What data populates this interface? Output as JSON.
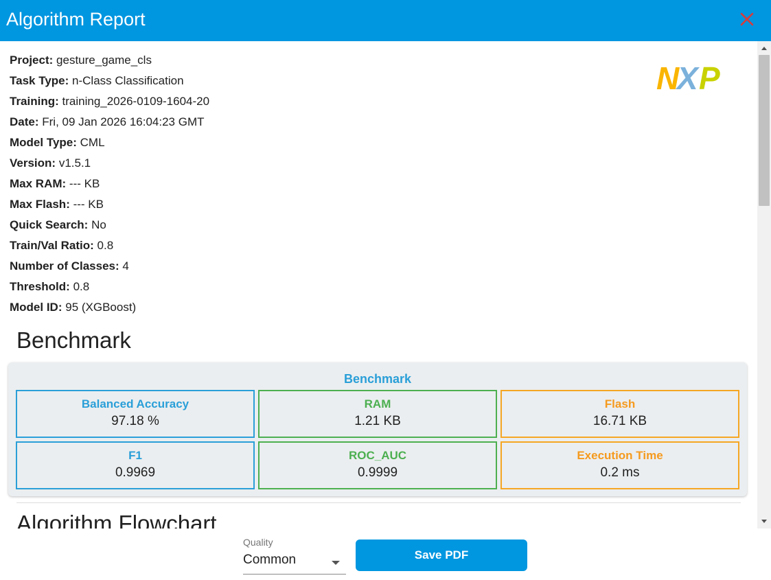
{
  "window": {
    "title": "Algorithm Report"
  },
  "meta": [
    {
      "key": "Project:",
      "value": "gesture_game_cls"
    },
    {
      "key": "Task Type:",
      "value": "n-Class Classification"
    },
    {
      "key": "Training:",
      "value": "training_2026-0109-1604-20"
    },
    {
      "key": "Date:",
      "value": "Fri, 09 Jan 2026 16:04:23 GMT"
    },
    {
      "key": "Model Type:",
      "value": "CML"
    },
    {
      "key": "Version:",
      "value": "v1.5.1"
    },
    {
      "key": "Max RAM:",
      "value": "--- KB"
    },
    {
      "key": "Max Flash:",
      "value": "--- KB"
    },
    {
      "key": "Quick Search:",
      "value": "No"
    },
    {
      "key": "Train/Val Ratio:",
      "value": "0.8"
    },
    {
      "key": "Number of Classes:",
      "value": "4"
    },
    {
      "key": "Threshold:",
      "value": "0.8"
    },
    {
      "key": "Model ID:",
      "value": "95 (XGBoost)"
    }
  ],
  "logo": {
    "text": "NXP",
    "colors": [
      "#f9b500",
      "#7bb1db",
      "#c9d200"
    ]
  },
  "benchmark": {
    "section_title": "Benchmark",
    "card_title": "Benchmark",
    "cells": [
      {
        "label": "Balanced Accuracy",
        "value": "97.18 %",
        "color": "#2a9fd8"
      },
      {
        "label": "RAM",
        "value": "1.21 KB",
        "color": "#4caf50"
      },
      {
        "label": "Flash",
        "value": "16.71 KB",
        "color": "#f5a623"
      },
      {
        "label": "F1",
        "value": "0.9969",
        "color": "#2a9fd8"
      },
      {
        "label": "ROC_AUC",
        "value": "0.9999",
        "color": "#4caf50"
      },
      {
        "label": "Execution Time",
        "value": "0.2 ms",
        "color": "#f5a623"
      }
    ]
  },
  "flowchart": {
    "section_title": "Algorithm Flowchart"
  },
  "footer": {
    "quality_label": "Quality",
    "quality_value": "Common",
    "save_label": "Save PDF"
  },
  "colors": {
    "accent": "#0096e0",
    "close": "#d93b3b"
  }
}
